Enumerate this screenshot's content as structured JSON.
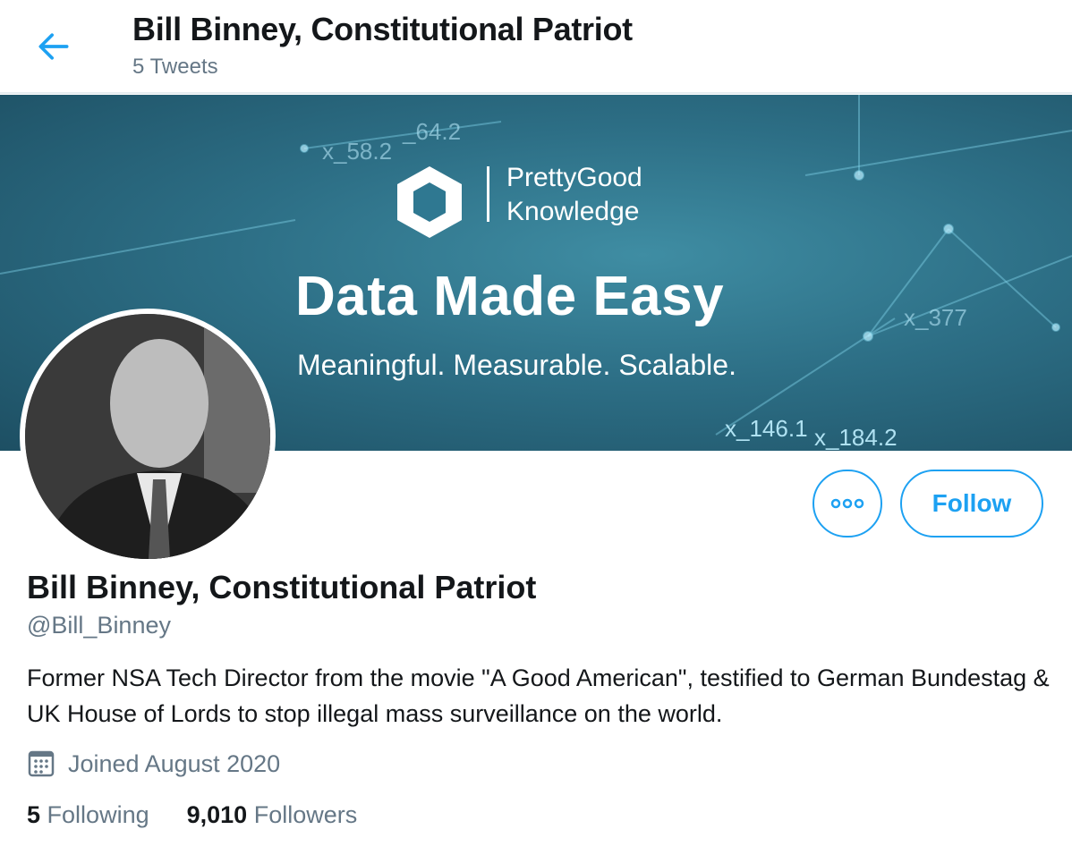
{
  "header": {
    "title": "Bill Binney, Constitutional Patriot",
    "subtitle": "5 Tweets"
  },
  "banner": {
    "brand_line1": "PrettyGood",
    "brand_line2": "Knowledge",
    "headline": "Data Made Easy",
    "tagline": "Meaningful. Measurable. Scalable.",
    "labels": [
      "x_58.2",
      "_64.2",
      "x_146.1",
      "x_184.2",
      "x_377"
    ]
  },
  "actions": {
    "follow_label": "Follow",
    "more_icon": "ellipsis-icon"
  },
  "profile": {
    "name": "Bill Binney, Constitutional Patriot",
    "handle": "@Bill_Binney",
    "bio": "Former NSA Tech Director from the movie \"A Good American\", testified to German Bundestag & UK House of Lords to stop illegal mass surveillance on the world.",
    "joined": "Joined August 2020",
    "following_count": "5",
    "following_label": "Following",
    "followers_count": "9,010",
    "followers_label": "Followers"
  },
  "colors": {
    "accent": "#1da1f2",
    "secondary_text": "#657786"
  }
}
